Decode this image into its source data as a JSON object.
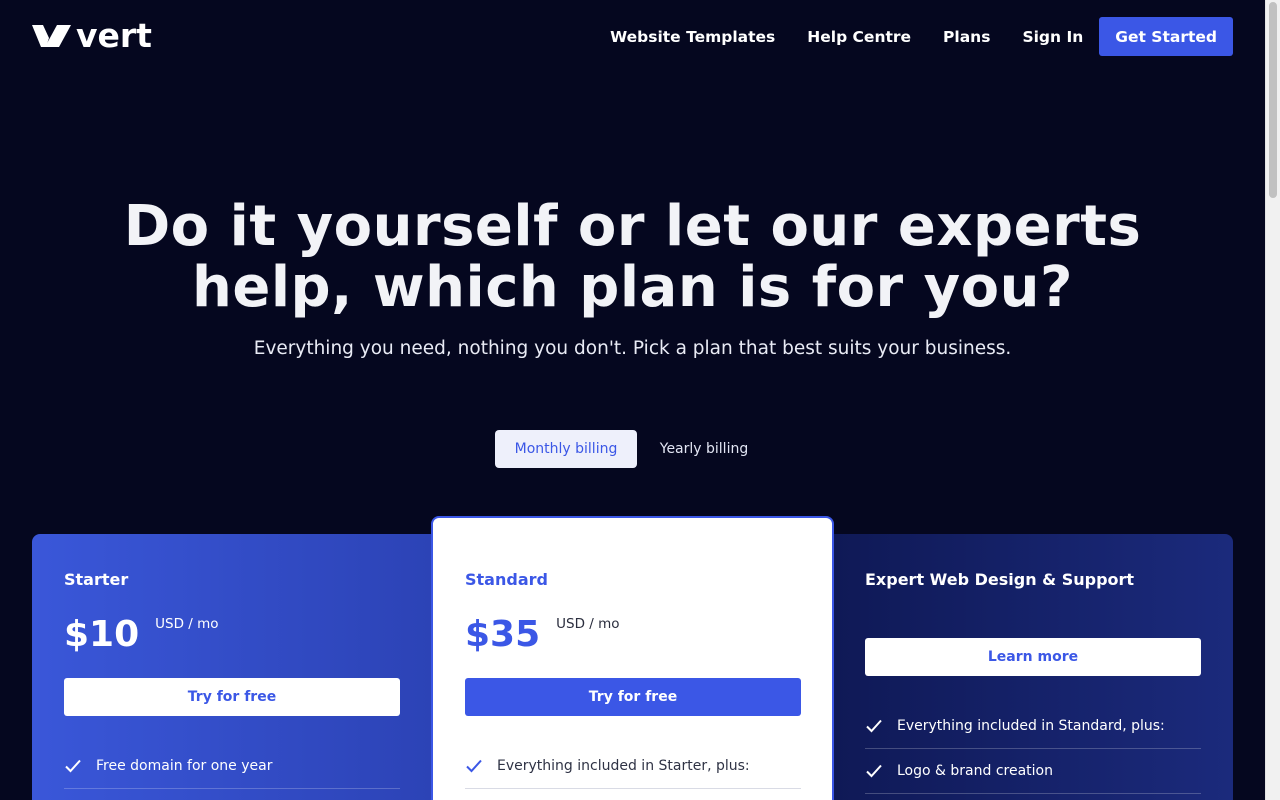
{
  "header": {
    "logo_text": "vert",
    "nav": [
      {
        "label": "Website Templates"
      },
      {
        "label": "Help Centre"
      },
      {
        "label": "Plans"
      },
      {
        "label": "Sign In"
      }
    ],
    "cta_label": "Get Started"
  },
  "hero": {
    "title_line1": "Do it yourself or let our experts",
    "title_line2": "help, which plan is for you?",
    "subtitle": "Everything you need, nothing you don't. Pick a plan that best suits your business."
  },
  "billing": {
    "monthly_label": "Monthly billing",
    "yearly_label": "Yearly billing",
    "selected": "monthly"
  },
  "plans": [
    {
      "name": "Starter",
      "price": "$10",
      "unit": "USD / mo",
      "button_label": "Try for free",
      "features": [
        "Free domain for one year"
      ]
    },
    {
      "name": "Standard",
      "price": "$35",
      "unit": "USD / mo",
      "button_label": "Try for free",
      "features": [
        "Everything included in Starter, plus:"
      ]
    },
    {
      "name": "Expert Web Design & Support",
      "button_label": "Learn more",
      "features": [
        "Everything included in Standard, plus:",
        "Logo & brand creation"
      ]
    }
  ],
  "colors": {
    "background": "#05071f",
    "accent": "#3b57e6",
    "starter_card": "#3a57d9",
    "expert_card": "#142068"
  },
  "icons": {
    "logo": "vert-logo-icon",
    "feature": "check-icon"
  }
}
